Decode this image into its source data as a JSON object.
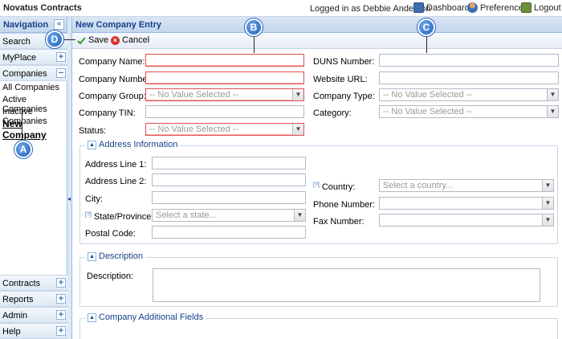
{
  "header": {
    "app_title": "Novatus Contracts",
    "user_info": "Logged in as Debbie Anderson",
    "links": {
      "dashboard": "Dashboard",
      "preferences": "Preferences",
      "logout": "Logout"
    }
  },
  "nav": {
    "title": "Navigation",
    "collapse_glyph": "«",
    "search": "Search",
    "myplace": "MyPlace",
    "companies": "Companies",
    "company_links": [
      "All Companies",
      "Active Companies",
      "Inactive Companies",
      "New Company"
    ],
    "bottom": [
      "Contracts",
      "Reports",
      "Admin",
      "Help"
    ],
    "plus": "+",
    "minus": "−"
  },
  "main": {
    "title": "New Company Entry",
    "toolbar": {
      "save": "Save",
      "cancel": "Cancel"
    },
    "left_fields": {
      "company_name": "Company Name:",
      "company_number": "Company Number:",
      "company_group": "Company Group:",
      "company_tin": "Company TIN:",
      "status": "Status:"
    },
    "right_fields": {
      "duns": "DUNS Number:",
      "website": "Website URL:",
      "company_type": "Company Type:",
      "category": "Category:"
    },
    "no_value": "-- No Value Selected --",
    "address": {
      "legend": "Address Information",
      "line1": "Address Line 1:",
      "line2": "Address Line 2:",
      "city": "City:",
      "state": "State/Province:",
      "state_placeholder": "Select a state...",
      "postal": "Postal Code:",
      "country": "Country:",
      "country_placeholder": "Select a country...",
      "phone": "Phone Number:",
      "fax": "Fax Number:"
    },
    "description": {
      "legend": "Description",
      "label": "Description:"
    },
    "additional": {
      "legend": "Company Additional Fields"
    },
    "required_marker": "[?]"
  },
  "callouts": {
    "a": "A",
    "b": "B",
    "c": "C",
    "d": "D"
  },
  "colors": {
    "header_text": "#15428b",
    "required_border": "#e05050",
    "callout": "#1f5fb8"
  }
}
